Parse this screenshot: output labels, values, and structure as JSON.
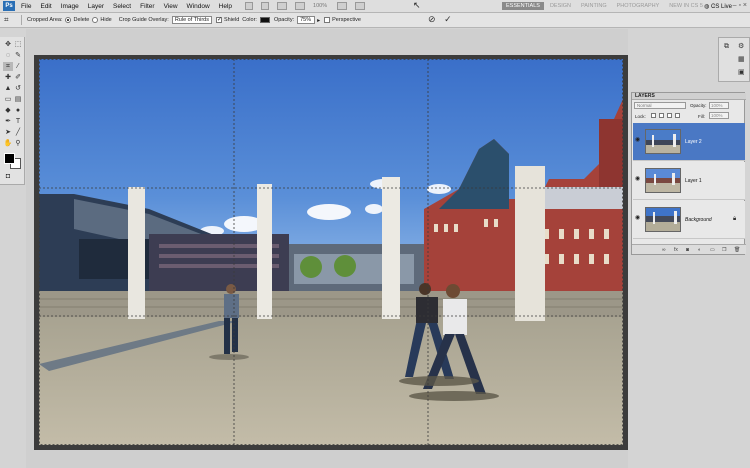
{
  "menubar": {
    "logo": "Ps",
    "items": [
      "File",
      "Edit",
      "Image",
      "Layer",
      "Select",
      "Filter",
      "View",
      "Window",
      "Help"
    ],
    "zoom": "100%",
    "workspaces": [
      "ESSENTIALS",
      "DESIGN",
      "PAINTING",
      "PHOTOGRAPHY",
      "NEW IN CS 5",
      "»"
    ],
    "cs_live": "CS Live",
    "window_controls": "– ▫ ×"
  },
  "options": {
    "cropped_area_label": "Cropped Area:",
    "delete_label": "Delete",
    "hide_label": "Hide",
    "overlay_label": "Crop Guide Overlay:",
    "overlay_value": "Rule of Thirds",
    "shield_label": "Shield",
    "color_label": "Color:",
    "shield_color": "#111111",
    "opacity_label": "Opacity:",
    "opacity_value": "75%",
    "perspective_label": "Perspective"
  },
  "layers_panel": {
    "tab": "LAYERS",
    "blend_mode": "Normal",
    "opacity_label": "Opacity:",
    "opacity_value": "100%",
    "lock_label": "Lock:",
    "fill_label": "Fill:",
    "fill_value": "100%",
    "layers": [
      {
        "name": "Layer 2",
        "selected": true
      },
      {
        "name": "Layer 1",
        "selected": false
      },
      {
        "name": "Background",
        "selected": false
      }
    ]
  },
  "colors": {
    "selection_blue": "#4a78c4",
    "sky_top": "#3a6fc9",
    "sky_bottom": "#9fc3ec",
    "ground": "#b9b3a0",
    "brick": "#a5423a"
  }
}
